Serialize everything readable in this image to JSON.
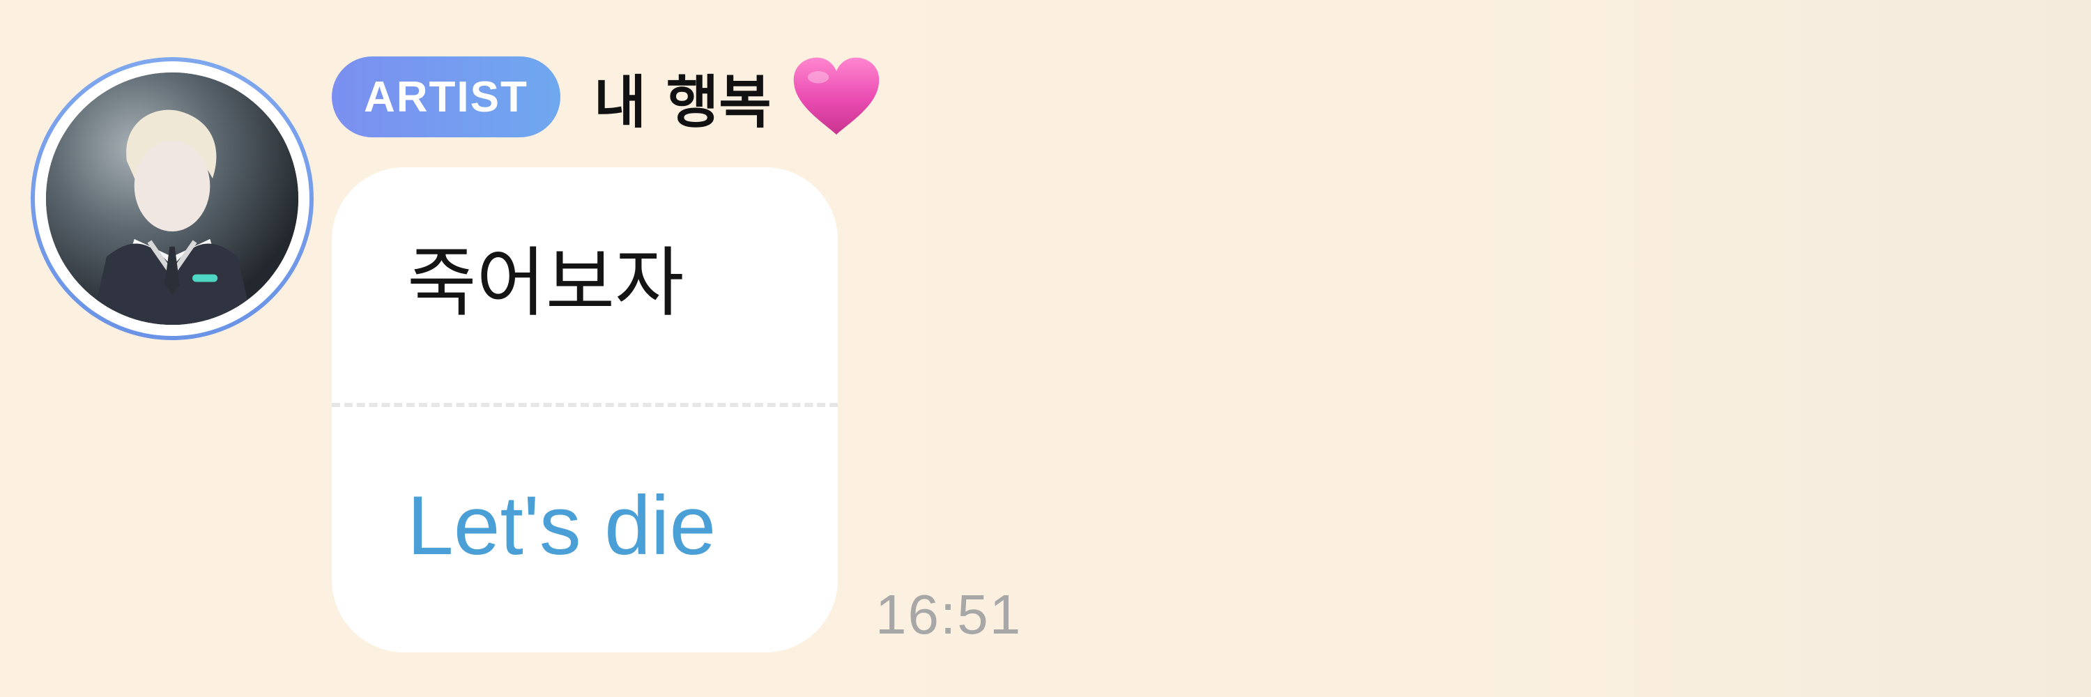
{
  "message": {
    "badge": "ARTIST",
    "sender_name": "내 행복",
    "sender_icon": "pink-heart-icon",
    "original_text": "죽어보자",
    "translated_text": "Let's die",
    "timestamp": "16:51"
  },
  "colors": {
    "background": "#fbf0df",
    "badge_start": "#7b8ff0",
    "badge_end": "#6fa8ef",
    "avatar_ring": "#7fa7ee",
    "translation_text": "#4a9fd6",
    "timestamp": "#a7a7a7",
    "heart": "#e94bb0"
  }
}
